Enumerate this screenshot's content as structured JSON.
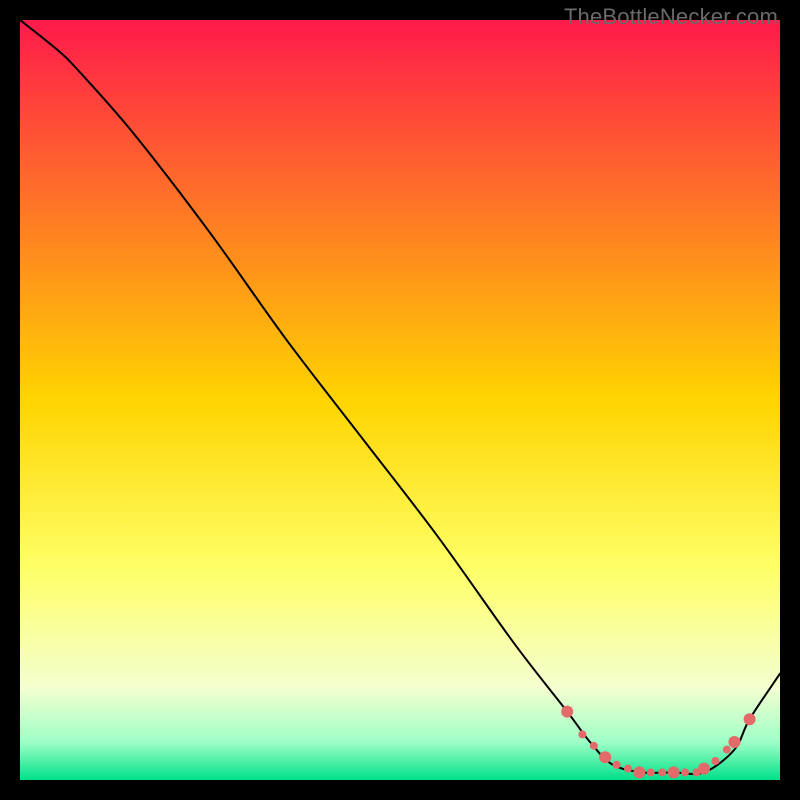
{
  "watermark": "TheBottleNecker.com",
  "chart_data": {
    "type": "line",
    "title": "",
    "xlabel": "",
    "ylabel": "",
    "xlim": [
      0,
      100
    ],
    "ylim": [
      0,
      100
    ],
    "grid": false,
    "legend": false,
    "background_gradient": {
      "stops": [
        {
          "offset": 0.0,
          "color": "#ff1a4b"
        },
        {
          "offset": 0.5,
          "color": "#ffd400"
        },
        {
          "offset": 0.72,
          "color": "#ffff66"
        },
        {
          "offset": 0.88,
          "color": "#f3ffd0"
        },
        {
          "offset": 0.95,
          "color": "#9fffc6"
        },
        {
          "offset": 1.0,
          "color": "#00e08a"
        }
      ]
    },
    "series": [
      {
        "name": "bottleneck-curve",
        "x": [
          0,
          5,
          8,
          15,
          25,
          35,
          45,
          55,
          65,
          72,
          75,
          78,
          82,
          86,
          90,
          94,
          96,
          100
        ],
        "y": [
          100,
          96,
          93,
          85,
          72,
          58,
          45,
          32,
          18,
          9,
          5,
          2,
          1,
          1,
          1,
          4,
          8,
          14
        ]
      }
    ],
    "markers": {
      "name": "highlight-dots",
      "x": [
        72,
        74,
        75.5,
        77,
        78.5,
        80,
        81.5,
        83,
        84.5,
        86,
        87.5,
        89,
        90,
        91.5,
        93,
        94,
        96
      ],
      "y": [
        9,
        6,
        4.5,
        3,
        2,
        1.5,
        1,
        1,
        1,
        1,
        1,
        1,
        1.5,
        2.5,
        4,
        5,
        8
      ],
      "color": "#e46a6a",
      "radius_primary": 6,
      "radius_small": 4
    }
  }
}
